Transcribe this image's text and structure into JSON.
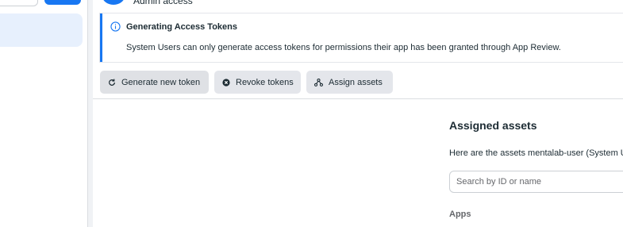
{
  "header": {
    "access_label": "Admin access"
  },
  "notice": {
    "title": "Generating Access Tokens",
    "body": "System Users can only generate access tokens for permissions their app has been granted through App Review."
  },
  "actions": {
    "generate": "Generate new token",
    "revoke": "Revoke tokens",
    "assign": "Assign assets"
  },
  "assigned_assets": {
    "title": "Assigned assets",
    "description": "Here are the assets mentalab-user (System U",
    "search_placeholder": "Search by ID or name",
    "apps_label": "Apps"
  },
  "colors": {
    "accent": "#1877f2",
    "button_bg": "#e4e6eb",
    "page_bg": "#f0f2f5"
  },
  "icons": {
    "notice": "info-icon",
    "generate": "refresh-icon",
    "revoke": "x-circle-icon",
    "assign": "share-nodes-icon"
  }
}
